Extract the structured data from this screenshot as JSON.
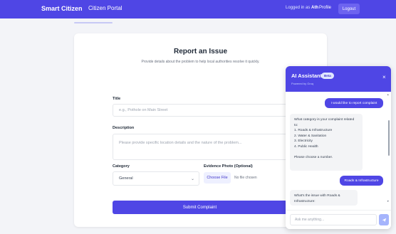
{
  "navbar": {
    "brand": "Smart Citizen",
    "portal": "Citizen Portal",
    "logged_prefix": "Logged in as",
    "logged_user": "Ath",
    "profile": "Profile",
    "logout": "Logout"
  },
  "form": {
    "title": "Report an Issue",
    "subtitle": "Provide details about the problem to help local authorities resolve it quickly.",
    "title_label": "Title",
    "title_placeholder": "e.g., Pothole on Main Street",
    "description_label": "Description",
    "description_placeholder": "Please provide specific location details and the nature of the problem...",
    "category_label": "Category",
    "category_value": "General",
    "photo_label": "Evidence Photo (Optional)",
    "choose_file": "Choose File",
    "no_file": "No file chosen",
    "submit": "Submit Complaint"
  },
  "chat": {
    "title": "AI Assistant",
    "badge": "Beta",
    "powered": "Powered by Groq",
    "close": "×",
    "msg1": "I would like to report complaint",
    "bot1": [
      "What category is your complaint related",
      "to:",
      "1. Roads & Infrastructure",
      "2. Water & Sanitation",
      "3. Electricity",
      "4. Public Health",
      "",
      "Please choose a number."
    ],
    "msg2": "Roads & Infrastructure",
    "bot2": [
      "What's the issue with Roads &",
      "Infrastructure:"
    ],
    "input_placeholder": "Ask me anything...",
    "icons": {
      "send": "send-icon",
      "close": "close-icon"
    }
  },
  "colors": {
    "primary": "#4f46e5",
    "badge": "#e0e7ff"
  }
}
